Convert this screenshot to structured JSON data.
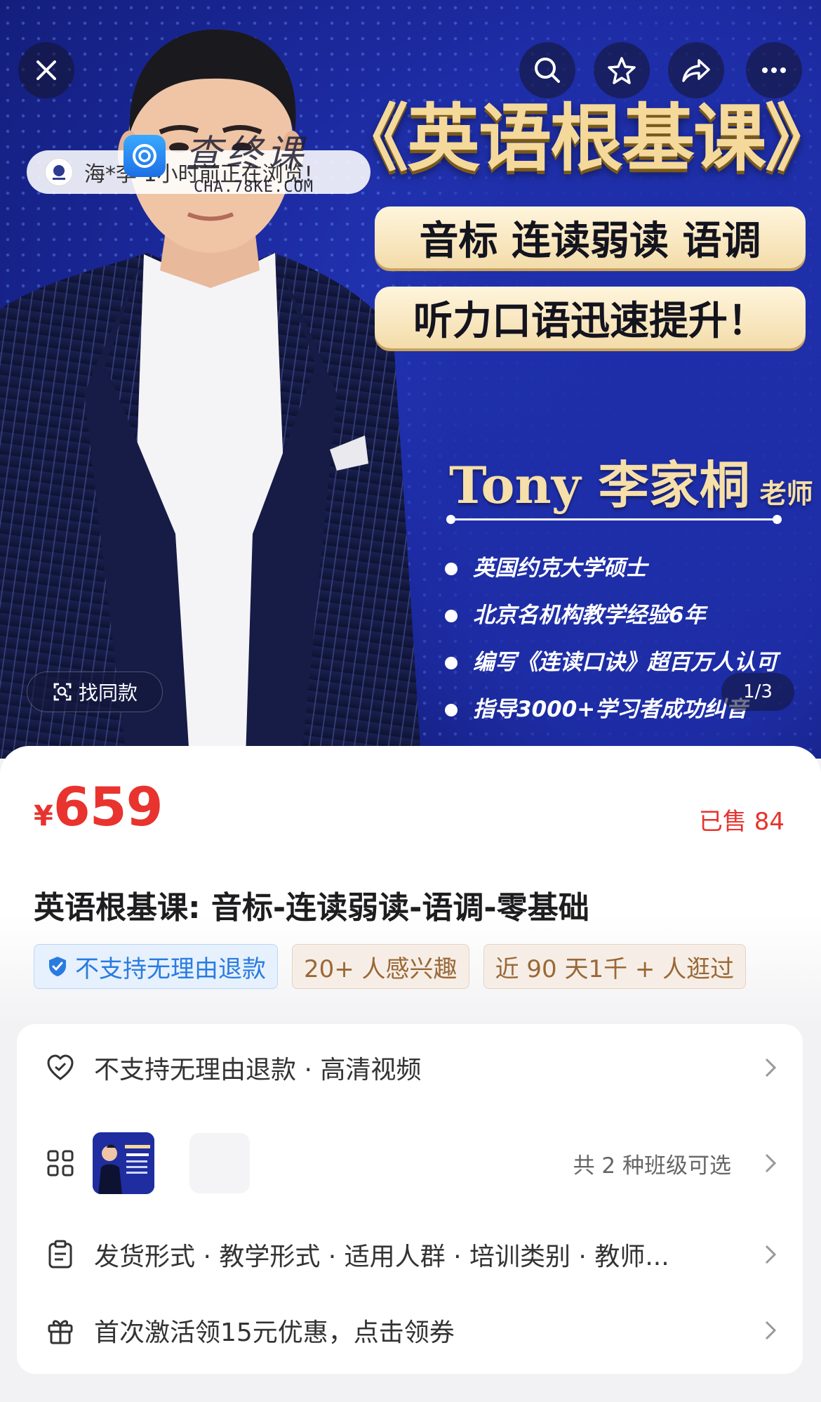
{
  "hero": {
    "course_title": "《英语根基课》",
    "pill_1": "音标 连读弱读 语调",
    "pill_2": "听力口语迅速提升！",
    "teacher_name": "Tony 李家桐",
    "teacher_title": "老师",
    "bullets": [
      "英国约克大学硕士",
      "北京名机构教学经验6年",
      "编写《连读口诀》超百万人认可",
      "指导3000+学习者成功纠音"
    ],
    "browse_toast": "海*李 1小时前正在浏览!",
    "watermark": "查终课",
    "watermark_domain": "CHA.78KE.COM",
    "find_same_label": "找同款",
    "page_indicator": "1/3"
  },
  "icons": [
    "close-icon",
    "search-icon",
    "star-icon",
    "share-icon",
    "more-icon"
  ],
  "product": {
    "currency": "¥",
    "price": "659",
    "sold": "已售 84",
    "title": "英语根基课: 音标-连读弱读-语调-零基础",
    "tags": [
      "不支持无理由退款",
      "20+ 人感兴趣",
      "近 90 天1千 + 人逛过"
    ]
  },
  "details": {
    "service": "不支持无理由退款 · 高清视频",
    "class_options": "共 2 种班级可选",
    "params": "发货形式 · 教学形式 · 适用人群 · 培训类别 · 教师...",
    "coupon": "首次激活领15元优惠，点击领券"
  },
  "colors": {
    "price_red": "#e8332e",
    "tag_blue": "#2a7be0",
    "tag_gold": "#9a6838",
    "hero_blue": "#1c2aa0",
    "gold_text": "#f4d99a"
  }
}
